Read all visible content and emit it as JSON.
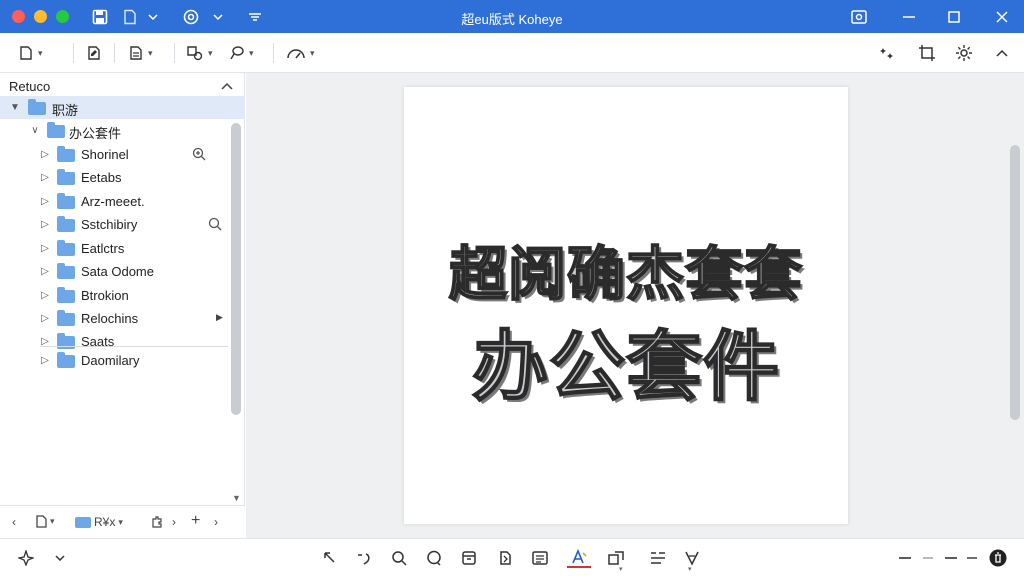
{
  "window": {
    "title": "超eu版式 Koheye",
    "controls": [
      "close",
      "minimize",
      "zoom"
    ]
  },
  "titlebar_icons": [
    "save-icon",
    "document-icon",
    "chevron-down-icon",
    "sync-icon",
    "chevron-down-icon",
    "menu-icon",
    "screenshot-icon",
    "minimize-icon",
    "maximize-icon",
    "close-icon"
  ],
  "toolbar": {
    "left_tools": [
      "new-page-icon",
      "edit-document-icon",
      "page-settings-icon",
      "crop-icon",
      "lasso-icon",
      "gauge-icon"
    ],
    "right_tools": [
      "sparkle-icon",
      "crop-frame-icon",
      "settings-icon",
      "chevron-up-icon"
    ]
  },
  "sidebar": {
    "title": "Retuco",
    "root": "职游",
    "subfolder": "办公套件",
    "items": [
      {
        "label": "Shorinel",
        "action": "zoom-in-icon"
      },
      {
        "label": "Eetabs",
        "action": ""
      },
      {
        "label": "Arz-meeet.",
        "action": ""
      },
      {
        "label": "Sstchibiry",
        "action": "search-icon"
      },
      {
        "label": "Eatlctrs",
        "action": ""
      },
      {
        "label": "Sata Odome",
        "action": ""
      },
      {
        "label": "Btrokion",
        "action": ""
      },
      {
        "label": "Relochins",
        "action": "expand-right-icon"
      },
      {
        "label": "Saats",
        "action": ""
      },
      {
        "label": "Daomilary",
        "action": ""
      }
    ],
    "footer": {
      "folder_label": "R¥x"
    }
  },
  "document": {
    "line1": "超阅确杰套套",
    "line2": "办公套件"
  },
  "bottom_tools": [
    "pointer-icon",
    "rotate-icon",
    "search-icon",
    "comment-icon",
    "stamp-icon",
    "file-export-icon",
    "notes-icon",
    "text-color-icon",
    "transform-icon",
    "list-icon",
    "filter-icon",
    "zoom-out-icon",
    "zoom-level-icon",
    "fit-icon",
    "trash-icon"
  ],
  "colors": {
    "titlebar": "#2f6fd8",
    "selection": "#dfe9f7",
    "folder": "#6ea7e8",
    "accent_underline": "#d9332b"
  }
}
